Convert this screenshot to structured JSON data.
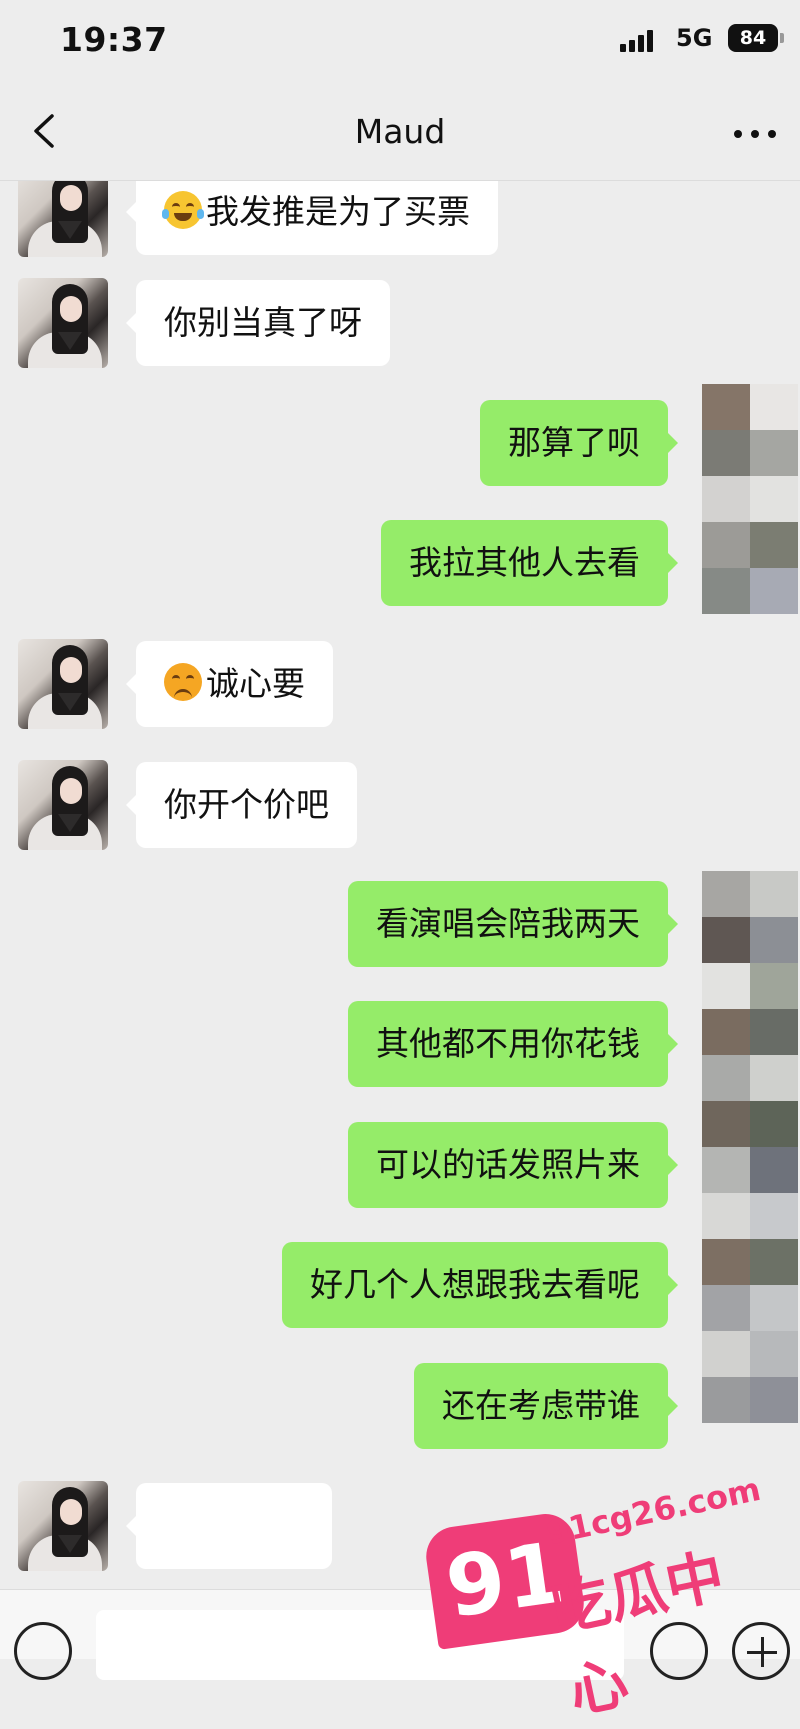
{
  "status_bar": {
    "time": "19:37",
    "network": "5G",
    "battery": "84"
  },
  "nav": {
    "title": "Maud",
    "back_icon": "chevron-left-icon",
    "more_icon": "more-dots-icon"
  },
  "messages": [
    {
      "side": "in",
      "emoji": "laughing-tears-emoji",
      "text": "我发推是为了买票"
    },
    {
      "side": "in",
      "text": "你别当真了呀"
    },
    {
      "side": "out",
      "text": "那算了呗"
    },
    {
      "side": "out",
      "text": "我拉其他人去看"
    },
    {
      "side": "in",
      "emoji": "sad-face-emoji",
      "text": "诚心要"
    },
    {
      "side": "in",
      "text": "你开个价吧"
    },
    {
      "side": "out",
      "text": "看演唱会陪我两天"
    },
    {
      "side": "out",
      "text": "其他都不用你花钱"
    },
    {
      "side": "out",
      "text": "可以的话发照片来"
    },
    {
      "side": "out",
      "text": "好几个人想跟我去看呢"
    },
    {
      "side": "out",
      "text": "还在考虑带谁"
    }
  ],
  "watermark": {
    "number": "91",
    "url": "91cg26.com",
    "name": "吃瓜中心",
    "color": "#ef3d78"
  },
  "colors": {
    "background": "#ededed",
    "outgoing_bubble": "#95ec69",
    "incoming_bubble": "#ffffff"
  }
}
